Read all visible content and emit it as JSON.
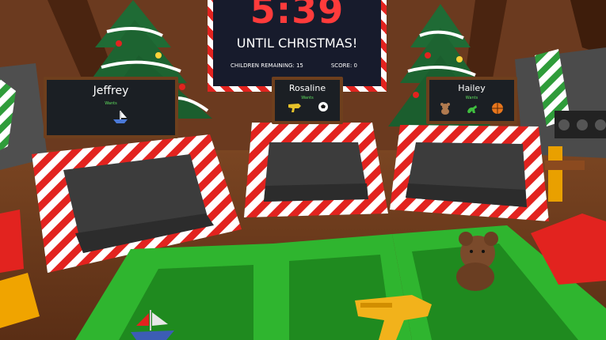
{
  "hud": {
    "countdown": "5:39",
    "until_text": "UNTIL CHRISTMAS!",
    "children_remaining": "CHILDREN REMAINING: 15",
    "score": "SCORE: 0"
  },
  "children": [
    {
      "name": "Jeffrey",
      "wants_label": "Wants",
      "toys": [
        "toy-boat-icon"
      ]
    },
    {
      "name": "Rosaline",
      "wants_label": "Wants",
      "toys": [
        "toy-gun-icon",
        "soccer-ball-icon"
      ]
    },
    {
      "name": "Hailey",
      "wants_label": "Wants",
      "toys": [
        "teddy-bear-icon",
        "toy-dinosaur-icon",
        "basketball-icon"
      ]
    }
  ],
  "colors": {
    "wall": "#6b3a1f",
    "candy_red": "#e2231f",
    "candy_white": "#ffffff",
    "bin_green": "#2fb52f",
    "clock_bg": "#171b2c",
    "time_red": "#ff3b3b",
    "want_green": "#5fe05f"
  }
}
